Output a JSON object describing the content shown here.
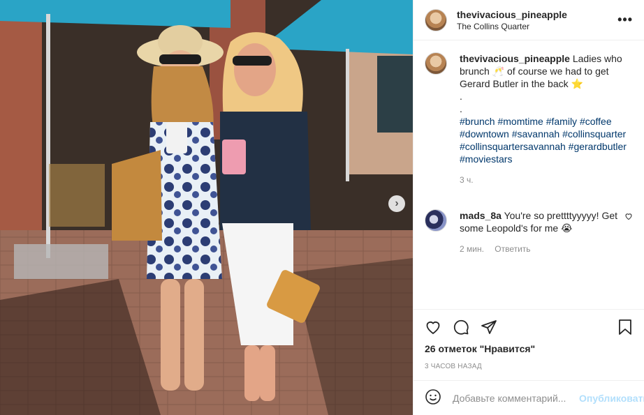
{
  "post": {
    "username": "thevivacious_pineapple",
    "location": "The Collins Quarter",
    "caption": "Ladies who brunch 🥂 of course we had to get Gerard Butler in the back ⭐",
    "dot1": ".",
    "dot2": ".",
    "hashtags": "#brunch #momtime #family #coffee #downtown #savannah #collinsquarter #collinsquartersavannah #gerardbutler #moviestars",
    "caption_time": "3 ч.",
    "more_label": "•••"
  },
  "comment": {
    "username": "mads_8a",
    "text": "You're so prettttyyyyy! Get some Leopold's for me 😭",
    "time": "2 мин.",
    "reply": "Ответить"
  },
  "actions": {
    "likes": "26 отметок \"Нравится\"",
    "timestamp": "3 часов назад"
  },
  "add_comment": {
    "placeholder": "Добавьте комментарий...",
    "publish": "Опубликовать"
  },
  "icons": [
    "emoji-icon",
    "heart-icon",
    "comment-icon",
    "share-icon",
    "bookmark-icon",
    "chevron-right-icon"
  ]
}
